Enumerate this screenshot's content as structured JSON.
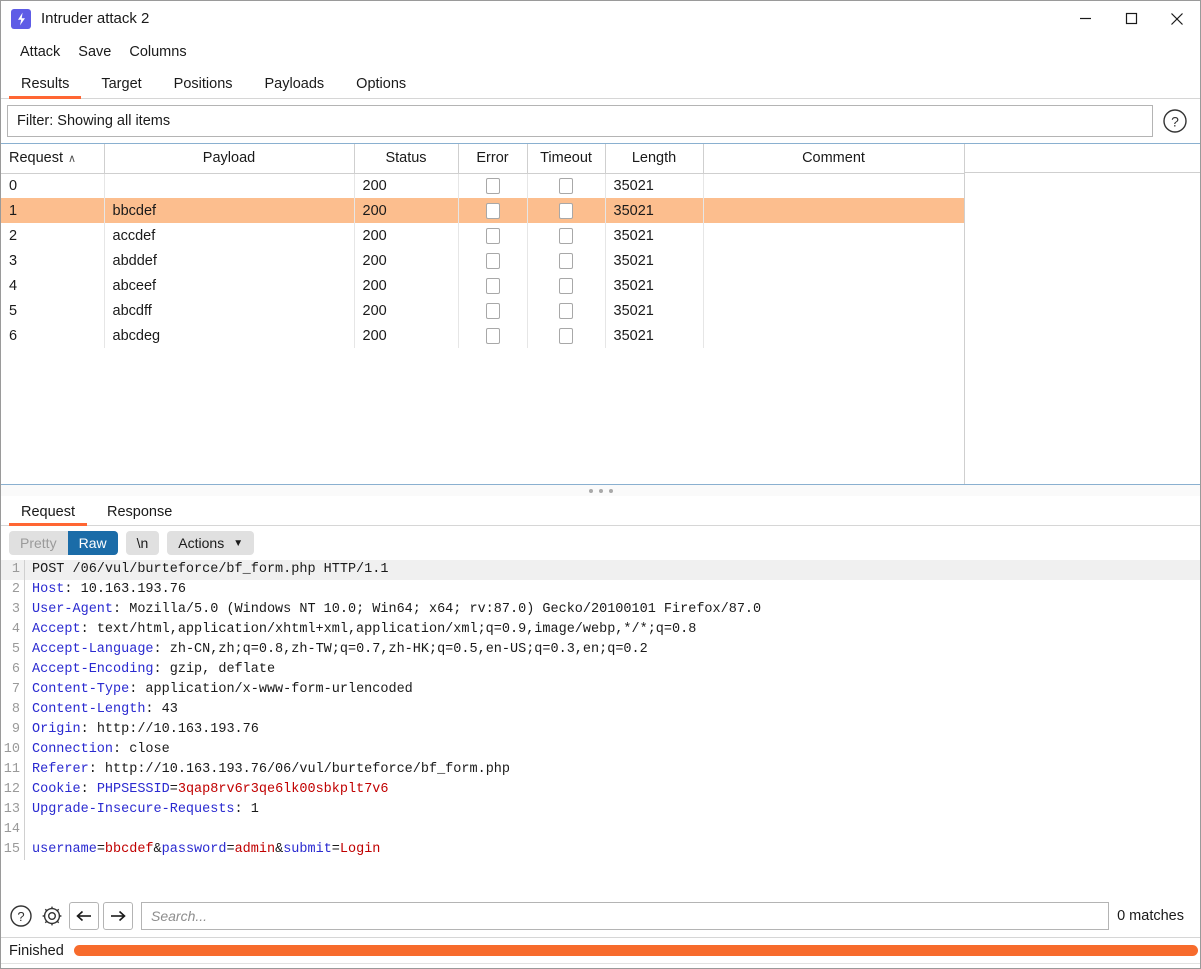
{
  "window": {
    "title": "Intruder attack 2",
    "icon": "lightning-bolt-icon",
    "controls": {
      "minimize": "minimize-icon",
      "maximize": "maximize-icon",
      "close": "close-icon"
    }
  },
  "menubar": {
    "items": [
      "Attack",
      "Save",
      "Columns"
    ]
  },
  "tabs": {
    "items": [
      "Results",
      "Target",
      "Positions",
      "Payloads",
      "Options"
    ],
    "active": "Results"
  },
  "filter": {
    "text": "Filter: Showing all items",
    "help_icon": "help-circle-icon"
  },
  "results_table": {
    "columns": [
      "Request",
      "Payload",
      "Status",
      "Error",
      "Timeout",
      "Length",
      "Comment"
    ],
    "sort_column": "Request",
    "sort_indicator": "∧",
    "selected_row_index": 1,
    "rows": [
      {
        "request": "0",
        "payload": "",
        "status": "200",
        "error": false,
        "timeout": false,
        "length": "35021",
        "comment": ""
      },
      {
        "request": "1",
        "payload": "bbcdef",
        "status": "200",
        "error": false,
        "timeout": false,
        "length": "35021",
        "comment": ""
      },
      {
        "request": "2",
        "payload": "accdef",
        "status": "200",
        "error": false,
        "timeout": false,
        "length": "35021",
        "comment": ""
      },
      {
        "request": "3",
        "payload": "abddef",
        "status": "200",
        "error": false,
        "timeout": false,
        "length": "35021",
        "comment": ""
      },
      {
        "request": "4",
        "payload": "abceef",
        "status": "200",
        "error": false,
        "timeout": false,
        "length": "35021",
        "comment": ""
      },
      {
        "request": "5",
        "payload": "abcdff",
        "status": "200",
        "error": false,
        "timeout": false,
        "length": "35021",
        "comment": ""
      },
      {
        "request": "6",
        "payload": "abcdeg",
        "status": "200",
        "error": false,
        "timeout": false,
        "length": "35021",
        "comment": ""
      }
    ]
  },
  "message_tabs": {
    "items": [
      "Request",
      "Response"
    ],
    "active": "Request"
  },
  "view_toolbar": {
    "pretty_label": "Pretty",
    "raw_label": "Raw",
    "raw_selected": true,
    "newline_label": "\\n",
    "actions_label": "Actions",
    "actions_chevron": "chevron-down-icon"
  },
  "request": {
    "lines": [
      {
        "n": "1",
        "plain": "POST /06/vul/burteforce/bf_form.php HTTP/1.1"
      },
      {
        "n": "2",
        "key": "Host",
        "value": " 10.163.193.76"
      },
      {
        "n": "3",
        "key": "User-Agent",
        "value": " Mozilla/5.0 (Windows NT 10.0; Win64; x64; rv:87.0) Gecko/20100101 Firefox/87.0"
      },
      {
        "n": "4",
        "key": "Accept",
        "value": " text/html,application/xhtml+xml,application/xml;q=0.9,image/webp,*/*;q=0.8"
      },
      {
        "n": "5",
        "key": "Accept-Language",
        "value": " zh-CN,zh;q=0.8,zh-TW;q=0.7,zh-HK;q=0.5,en-US;q=0.3,en;q=0.2"
      },
      {
        "n": "6",
        "key": "Accept-Encoding",
        "value": " gzip, deflate"
      },
      {
        "n": "7",
        "key": "Content-Type",
        "value": " application/x-www-form-urlencoded"
      },
      {
        "n": "8",
        "key": "Content-Length",
        "value": " 43"
      },
      {
        "n": "9",
        "key": "Origin",
        "value": " http://10.163.193.76"
      },
      {
        "n": "10",
        "key": "Connection",
        "value": " close"
      },
      {
        "n": "11",
        "key": "Referer",
        "value": " http://10.163.193.76/06/vul/burteforce/bf_form.php"
      },
      {
        "n": "12",
        "key": "Cookie",
        "value": " ",
        "cookie_name": "PHPSESSID",
        "cookie_value": "3qap8rv6r3qe6lk00sbkplt7v6"
      },
      {
        "n": "13",
        "key": "Upgrade-Insecure-Requests",
        "value": " 1"
      },
      {
        "n": "14",
        "plain": ""
      },
      {
        "n": "15",
        "body_params": [
          {
            "name": "username",
            "value": "bbcdef"
          },
          {
            "name": "password",
            "value": "admin"
          },
          {
            "name": "submit",
            "value": "Login"
          }
        ]
      }
    ]
  },
  "search_bar": {
    "help_icon": "help-circle-icon",
    "settings_icon": "gear-icon",
    "back_icon": "arrow-left-icon",
    "forward_icon": "arrow-right-icon",
    "placeholder": "Search...",
    "value": "",
    "matches": "0 matches"
  },
  "statusbar": {
    "label": "Finished",
    "progress_percent": 100
  },
  "colors": {
    "accent": "#ff6633",
    "progress": "#f76b2c",
    "selected_row": "#fcbe8e",
    "raw_selected": "#1b6ca8",
    "app_icon": "#5e5ce6",
    "header_key": "#2a2ad0",
    "header_value": "#c00000"
  }
}
